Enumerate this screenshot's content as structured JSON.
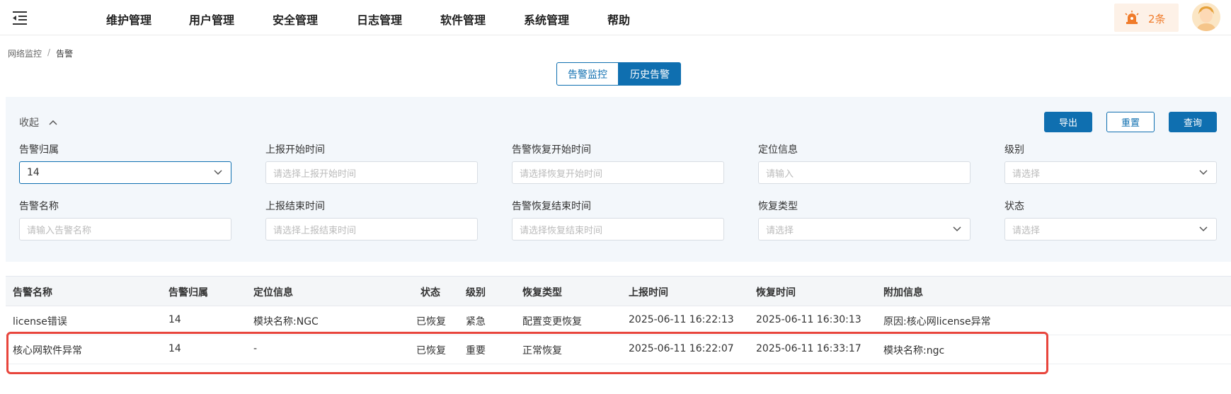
{
  "nav": {
    "items": [
      "维护管理",
      "用户管理",
      "安全管理",
      "日志管理",
      "软件管理",
      "系统管理",
      "帮助"
    ],
    "alert_count": "2条",
    "alert_color": "#f07b2a",
    "menu_icon": "menu-fold-icon",
    "alarm_icon": "alarm-light-icon"
  },
  "breadcrumb": {
    "parent": "网络监控",
    "separator": "/",
    "current": "告警"
  },
  "tabs": {
    "monitor": "告警监控",
    "history": "历史告警",
    "active": "历史告警"
  },
  "filters": {
    "collapse_label": "收起",
    "buttons": {
      "export": "导出",
      "reset": "重置",
      "query": "查询"
    },
    "alarm_owner": {
      "label": "告警归属",
      "value": "14"
    },
    "report_start": {
      "label": "上报开始时间",
      "placeholder": "请选择上报开始时间"
    },
    "recover_start": {
      "label": "告警恢复开始时间",
      "placeholder": "请选择恢复开始时间"
    },
    "location": {
      "label": "定位信息",
      "placeholder": "请输入"
    },
    "level": {
      "label": "级别",
      "placeholder": "请选择"
    },
    "alarm_name": {
      "label": "告警名称",
      "placeholder": "请输入告警名称"
    },
    "report_end": {
      "label": "上报结束时间",
      "placeholder": "请选择上报结束时间"
    },
    "recover_end": {
      "label": "告警恢复结束时间",
      "placeholder": "请选择恢复结束时间"
    },
    "recover_type": {
      "label": "恢复类型",
      "placeholder": "请选择"
    },
    "status": {
      "label": "状态",
      "placeholder": "请选择"
    }
  },
  "table": {
    "headers": [
      "告警名称",
      "告警归属",
      "定位信息",
      "状态",
      "级别",
      "恢复类型",
      "上报时间",
      "恢复时间",
      "附加信息"
    ],
    "rows": [
      [
        "license错误",
        "14",
        "模块名称:NGC",
        "已恢复",
        "紧急",
        "配置变更恢复",
        "2025-06-11 16:22:13",
        "2025-06-11 16:30:13",
        "原因:核心网license异常"
      ],
      [
        "核心网软件异常",
        "14",
        "-",
        "已恢复",
        "重要",
        "正常恢复",
        "2025-06-11 16:22:07",
        "2025-06-11 16:33:17",
        "模块名称:ngc"
      ]
    ]
  },
  "colors": {
    "primary": "#0f6fb0",
    "highlight": "#e8453c"
  }
}
